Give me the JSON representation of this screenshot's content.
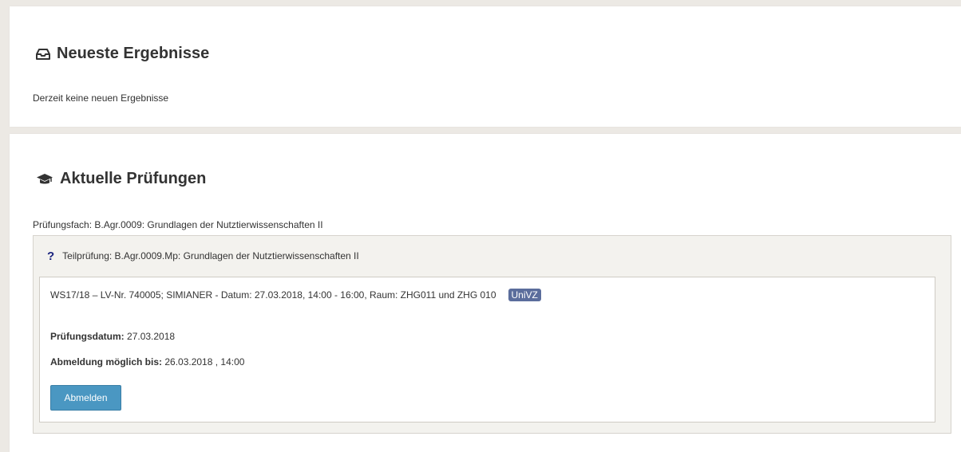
{
  "results": {
    "icon": "inbox-icon",
    "title": "Neueste Ergebnisse",
    "empty_message": "Derzeit keine neuen Ergebnisse"
  },
  "exams": {
    "icon": "graduation-cap-icon",
    "title": "Aktuelle Prüfungen",
    "subject": "Prüfungsfach: B.Agr.0009: Grundlagen der Nutztierwissenschaften II",
    "part_exam": {
      "icon": "question-icon",
      "title": "Teilprüfung: B.Agr.0009.Mp: Grundlagen der Nutztierwissenschaften II",
      "appointment": {
        "title": "WS17/18 – LV-Nr. 740005; SIMIANER - Datum: 27.03.2018, 14:00 - 16:00, Raum: ZHG011 und ZHG 010",
        "badge": "UniVZ",
        "exam_date_label": "Prüfungsdatum:",
        "exam_date_value": "27.03.2018",
        "deregistration_label": "Abmeldung möglich bis:",
        "deregistration_value": "26.03.2018 , 14:00",
        "deregister_button": "Abmelden"
      }
    }
  },
  "colors": {
    "button": "#4a97c2",
    "badge": "#5b6d9c",
    "question_icon": "#1a237e"
  }
}
